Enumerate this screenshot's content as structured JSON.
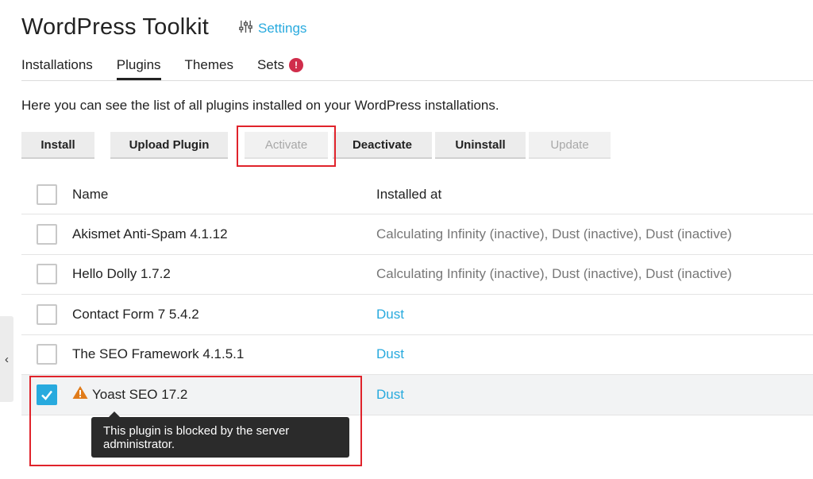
{
  "page": {
    "title": "WordPress Toolkit",
    "settings_label": "Settings",
    "intro": "Here you can see the list of all plugins installed on your WordPress installations."
  },
  "tabs": [
    {
      "label": "Installations",
      "active": false
    },
    {
      "label": "Plugins",
      "active": true
    },
    {
      "label": "Themes",
      "active": false
    },
    {
      "label": "Sets",
      "active": false,
      "badge": "!"
    }
  ],
  "toolbar": {
    "install": "Install",
    "upload": "Upload Plugin",
    "activate": "Activate",
    "deactivate": "Deactivate",
    "uninstall": "Uninstall",
    "update": "Update"
  },
  "table": {
    "col_name": "Name",
    "col_installed": "Installed at",
    "rows": [
      {
        "name": "Akismet Anti-Spam 4.1.12",
        "installed": "Calculating Infinity (inactive), Dust (inactive), Dust (inactive)",
        "checked": false
      },
      {
        "name": "Hello Dolly 1.7.2",
        "installed": "Calculating Infinity (inactive), Dust (inactive), Dust (inactive)",
        "checked": false
      },
      {
        "name": "Contact Form 7 5.4.2",
        "installed": "Dust",
        "checked": false
      },
      {
        "name": "The SEO Framework 4.1.5.1",
        "installed": "Dust",
        "checked": false
      },
      {
        "name": "Yoast SEO 17.2",
        "installed": "Dust",
        "checked": true,
        "warning": true
      }
    ]
  },
  "tooltip": "This plugin is blocked by the server administrator.",
  "side_toggle": "‹",
  "colors": {
    "accent": "#28aade",
    "badge": "#d02d4b",
    "highlight": "#e0232b",
    "warning": "#e07b1a"
  }
}
